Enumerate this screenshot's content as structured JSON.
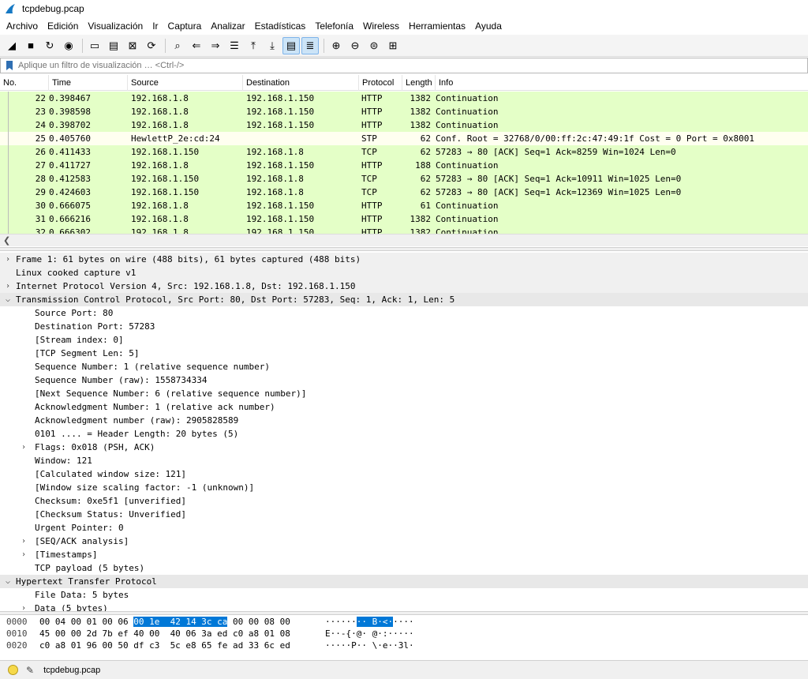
{
  "window": {
    "title": "tcpdebug.pcap"
  },
  "menu": [
    "Archivo",
    "Edición",
    "Visualización",
    "Ir",
    "Captura",
    "Analizar",
    "Estadísticas",
    "Telefonía",
    "Wireless",
    "Herramientas",
    "Ayuda"
  ],
  "toolbar": [
    {
      "icon": "shark-fin-start-icon",
      "glyph": "◢"
    },
    {
      "icon": "stop-icon",
      "glyph": "■"
    },
    {
      "icon": "restart-icon",
      "glyph": "↻"
    },
    {
      "icon": "capture-options-icon",
      "glyph": "◉"
    },
    {
      "sep": true
    },
    {
      "icon": "open-file-icon",
      "glyph": "▭"
    },
    {
      "icon": "save-file-icon",
      "glyph": "▤"
    },
    {
      "icon": "close-file-icon",
      "glyph": "⊠"
    },
    {
      "icon": "reload-icon",
      "glyph": "⟳"
    },
    {
      "sep": true
    },
    {
      "icon": "find-icon",
      "glyph": "⌕"
    },
    {
      "icon": "go-back-icon",
      "glyph": "⇐"
    },
    {
      "icon": "go-forward-icon",
      "glyph": "⇒"
    },
    {
      "icon": "go-to-packet-icon",
      "glyph": "☰"
    },
    {
      "icon": "go-first-icon",
      "glyph": "⤒"
    },
    {
      "icon": "go-last-icon",
      "glyph": "⤓"
    },
    {
      "icon": "autoscroll-icon",
      "glyph": "▤",
      "active": true
    },
    {
      "icon": "colorize-icon",
      "glyph": "≣",
      "active": true
    },
    {
      "sep": true
    },
    {
      "icon": "zoom-in-icon",
      "glyph": "⊕"
    },
    {
      "icon": "zoom-out-icon",
      "glyph": "⊖"
    },
    {
      "icon": "zoom-normal-icon",
      "glyph": "⊜"
    },
    {
      "icon": "resize-columns-icon",
      "glyph": "⊞"
    }
  ],
  "filter": {
    "placeholder": "Aplique un filtro de visualización … <Ctrl-/>"
  },
  "packet_list": {
    "columns": [
      "No.",
      "Time",
      "Source",
      "Destination",
      "Protocol",
      "Length",
      "Info"
    ],
    "rows": [
      {
        "no": "22",
        "time": "0.398467",
        "src": "192.168.1.8",
        "dst": "192.168.1.150",
        "proto": "HTTP",
        "len": "1382",
        "info": "Continuation",
        "kind": "tcp"
      },
      {
        "no": "23",
        "time": "0.398598",
        "src": "192.168.1.8",
        "dst": "192.168.1.150",
        "proto": "HTTP",
        "len": "1382",
        "info": "Continuation",
        "kind": "tcp"
      },
      {
        "no": "24",
        "time": "0.398702",
        "src": "192.168.1.8",
        "dst": "192.168.1.150",
        "proto": "HTTP",
        "len": "1382",
        "info": "Continuation",
        "kind": "tcp"
      },
      {
        "no": "25",
        "time": "0.405760",
        "src": "HewlettP_2e:cd:24",
        "dst": "",
        "proto": "STP",
        "len": "62",
        "info": "Conf. Root = 32768/0/00:ff:2c:47:49:1f  Cost = 0  Port = 0x8001",
        "kind": "stp"
      },
      {
        "no": "26",
        "time": "0.411433",
        "src": "192.168.1.150",
        "dst": "192.168.1.8",
        "proto": "TCP",
        "len": "62",
        "info": "57283 → 80 [ACK] Seq=1 Ack=8259 Win=1024 Len=0",
        "kind": "tcp"
      },
      {
        "no": "27",
        "time": "0.411727",
        "src": "192.168.1.8",
        "dst": "192.168.1.150",
        "proto": "HTTP",
        "len": "188",
        "info": "Continuation",
        "kind": "tcp"
      },
      {
        "no": "28",
        "time": "0.412583",
        "src": "192.168.1.150",
        "dst": "192.168.1.8",
        "proto": "TCP",
        "len": "62",
        "info": "57283 → 80 [ACK] Seq=1 Ack=10911 Win=1025 Len=0",
        "kind": "tcp"
      },
      {
        "no": "29",
        "time": "0.424603",
        "src": "192.168.1.150",
        "dst": "192.168.1.8",
        "proto": "TCP",
        "len": "62",
        "info": "57283 → 80 [ACK] Seq=1 Ack=12369 Win=1025 Len=0",
        "kind": "tcp"
      },
      {
        "no": "30",
        "time": "0.666075",
        "src": "192.168.1.8",
        "dst": "192.168.1.150",
        "proto": "HTTP",
        "len": "61",
        "info": "Continuation",
        "kind": "tcp"
      },
      {
        "no": "31",
        "time": "0.666216",
        "src": "192.168.1.8",
        "dst": "192.168.1.150",
        "proto": "HTTP",
        "len": "1382",
        "info": "Continuation",
        "kind": "tcp"
      },
      {
        "no": "32",
        "time": "0.666302",
        "src": "192.168.1.8",
        "dst": "192.168.1.150",
        "proto": "HTTP",
        "len": "1382",
        "info": "Continuation",
        "kind": "tcp"
      }
    ]
  },
  "details": [
    {
      "level": 0,
      "expander": ">",
      "text": "Frame 1: 61 bytes on wire (488 bits), 61 bytes captured (488 bits)"
    },
    {
      "level": 0,
      "expander": "",
      "text": "Linux cooked capture v1"
    },
    {
      "level": 0,
      "expander": ">",
      "text": "Internet Protocol Version 4, Src: 192.168.1.8, Dst: 192.168.1.150"
    },
    {
      "level": 0,
      "expander": "v",
      "text": "Transmission Control Protocol, Src Port: 80, Dst Port: 57283, Seq: 1, Ack: 1, Len: 5"
    },
    {
      "level": 1,
      "expander": "",
      "text": "Source Port: 80"
    },
    {
      "level": 1,
      "expander": "",
      "text": "Destination Port: 57283"
    },
    {
      "level": 1,
      "expander": "",
      "text": "[Stream index: 0]"
    },
    {
      "level": 1,
      "expander": "",
      "text": "[TCP Segment Len: 5]"
    },
    {
      "level": 1,
      "expander": "",
      "text": "Sequence Number: 1    (relative sequence number)"
    },
    {
      "level": 1,
      "expander": "",
      "text": "Sequence Number (raw): 1558734334"
    },
    {
      "level": 1,
      "expander": "",
      "text": "[Next Sequence Number: 6    (relative sequence number)]"
    },
    {
      "level": 1,
      "expander": "",
      "text": "Acknowledgment Number: 1    (relative ack number)"
    },
    {
      "level": 1,
      "expander": "",
      "text": "Acknowledgment number (raw): 2905828589"
    },
    {
      "level": 1,
      "expander": "",
      "text": "0101 .... = Header Length: 20 bytes (5)"
    },
    {
      "level": 1,
      "expander": ">",
      "text": "Flags: 0x018 (PSH, ACK)"
    },
    {
      "level": 1,
      "expander": "",
      "text": "Window: 121"
    },
    {
      "level": 1,
      "expander": "",
      "text": "[Calculated window size: 121]"
    },
    {
      "level": 1,
      "expander": "",
      "text": "[Window size scaling factor: -1 (unknown)]"
    },
    {
      "level": 1,
      "expander": "",
      "text": "Checksum: 0xe5f1 [unverified]"
    },
    {
      "level": 1,
      "expander": "",
      "text": "[Checksum Status: Unverified]"
    },
    {
      "level": 1,
      "expander": "",
      "text": "Urgent Pointer: 0"
    },
    {
      "level": 1,
      "expander": ">",
      "text": "[SEQ/ACK analysis]"
    },
    {
      "level": 1,
      "expander": ">",
      "text": "[Timestamps]"
    },
    {
      "level": 1,
      "expander": "",
      "text": "TCP payload (5 bytes)"
    },
    {
      "level": 0,
      "expander": "v",
      "text": "Hypertext Transfer Protocol"
    },
    {
      "level": 1,
      "expander": "",
      "text": "File Data: 5 bytes"
    },
    {
      "level": 1,
      "expander": ">",
      "text": "Data (5 bytes)"
    }
  ],
  "bytes": [
    {
      "offset": "0000",
      "hex_pre": "00 04 00 01 00 06 ",
      "hex_sel": "00 1e  42 14 3c ca",
      "hex_post": " 00 00 08 00",
      "ascii_pre": "······",
      "ascii_sel": "·· B·<·",
      "ascii_post": "····"
    },
    {
      "offset": "0010",
      "hex_pre": "45 00 00 2d 7b ef 40 00  40 06 3a ed c0 a8 01 08",
      "hex_sel": "",
      "hex_post": "",
      "ascii_pre": "E··-{·@· @·:·····",
      "ascii_sel": "",
      "ascii_post": ""
    },
    {
      "offset": "0020",
      "hex_pre": "c0 a8 01 96 00 50 df c3  5c e8 65 fe ad 33 6c ed",
      "hex_sel": "",
      "hex_post": "",
      "ascii_pre": "·····P·· \\·e··3l·",
      "ascii_sel": "",
      "ascii_post": ""
    }
  ],
  "status": {
    "file": "tcpdebug.pcap"
  }
}
